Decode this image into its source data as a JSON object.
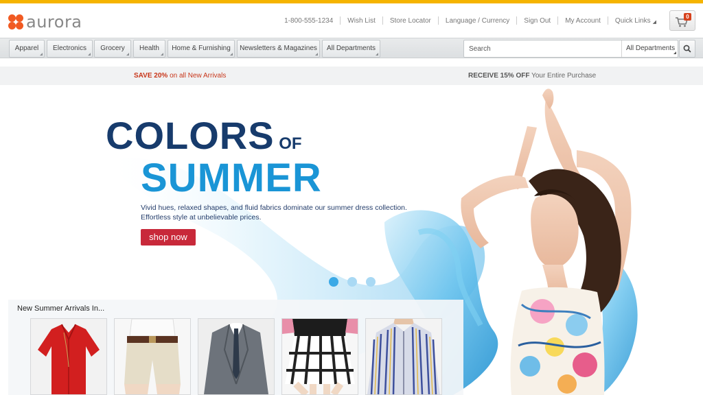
{
  "brand": {
    "name": "aurora",
    "color": "#f15a22",
    "icon": "aurora-logo-mark"
  },
  "header": {
    "util_links": [
      {
        "label": "1-800-555-1234"
      },
      {
        "label": "Wish List"
      },
      {
        "label": "Store Locator"
      },
      {
        "label": "Language / Currency"
      },
      {
        "label": "Sign Out"
      },
      {
        "label": "My Account"
      },
      {
        "label": "Quick Links"
      }
    ],
    "cart": {
      "count": "0",
      "icon": "shopping-cart-icon"
    }
  },
  "nav": {
    "departments": [
      {
        "label": "Apparel"
      },
      {
        "label": "Electronics"
      },
      {
        "label": "Grocery"
      },
      {
        "label": "Health"
      },
      {
        "label": "Home & Furnishing"
      },
      {
        "label": "Newsletters & Magazines"
      },
      {
        "label": "All Departments"
      }
    ],
    "search": {
      "placeholder": "Search",
      "department": "All Departments",
      "icon": "search-icon"
    }
  },
  "promo": {
    "left_strong": "SAVE 20%",
    "left_text": " on all New Arrivals",
    "right_strong": "RECEIVE 15% OFF",
    "right_text": " Your Entire Purchase"
  },
  "hero": {
    "headline_main": "COLORS",
    "headline_of": " OF",
    "headline_second": "SUMMER",
    "description": "Vivid hues, relaxed shapes, and fluid fabrics dominate our summer dress collection. Effortless style at unbelievable prices.",
    "cta": "shop now",
    "slides_total": 3,
    "active_slide": 1
  },
  "arrivals": {
    "title": "New Summer Arrivals In...",
    "products": [
      {
        "name": "red-blouse"
      },
      {
        "name": "khaki-shorts"
      },
      {
        "name": "grey-suit"
      },
      {
        "name": "plaid-skirt"
      },
      {
        "name": "striped-shirt"
      }
    ]
  },
  "colors": {
    "accent": "#f5b400",
    "cta": "#c8293a",
    "headline_dark": "#173b6c",
    "headline_light": "#1a95d6",
    "promo_red": "#c8361a"
  }
}
